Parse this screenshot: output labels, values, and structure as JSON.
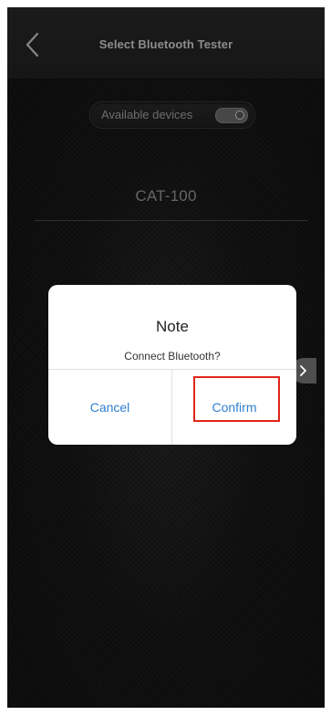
{
  "header": {
    "title": "Select Bluetooth Tester",
    "back_icon": "chevron-left-icon"
  },
  "available_devices": {
    "label": "Available devices",
    "toggle_on": false
  },
  "devices": [
    {
      "name": "CAT-100"
    }
  ],
  "dialog": {
    "title": "Note",
    "message": "Connect Bluetooth?",
    "cancel_label": "Cancel",
    "confirm_label": "Confirm",
    "button_color": "#2f7fd0",
    "highlight_color": "#e0241b"
  },
  "side_handle": {
    "icon": "chevron-right-icon"
  }
}
